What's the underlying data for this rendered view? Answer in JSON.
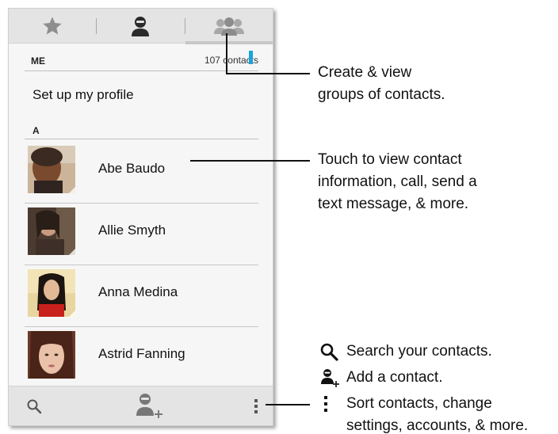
{
  "tabs": [
    {
      "icon": "star-icon",
      "name": "Favorites"
    },
    {
      "icon": "person-icon",
      "name": "Contacts"
    },
    {
      "icon": "group-icon",
      "name": "Groups"
    }
  ],
  "list": {
    "me_header": "ME",
    "contact_count": "107 contacts",
    "profile_label": "Set up my profile",
    "section_letter": "A"
  },
  "contacts": [
    {
      "name": "Abe Baudo"
    },
    {
      "name": "Allie Smyth"
    },
    {
      "name": "Anna Medina"
    },
    {
      "name": "Astrid Fanning"
    }
  ],
  "bottom_bar": {
    "search_icon": "search-icon",
    "add_contact_icon": "add-person-icon",
    "menu_icon": "overflow-menu-icon"
  },
  "callouts": {
    "groups": [
      "Create & view",
      "groups of contacts."
    ],
    "contact": [
      "Touch to view contact",
      "information, call, send a",
      "text message, & more."
    ]
  },
  "legend": {
    "search": "Search your contacts.",
    "add": "Add a contact.",
    "menu_line1": "Sort contacts, change",
    "menu_line2": "settings, accounts, & more."
  },
  "colors": {
    "accent": "#1aa3db"
  }
}
